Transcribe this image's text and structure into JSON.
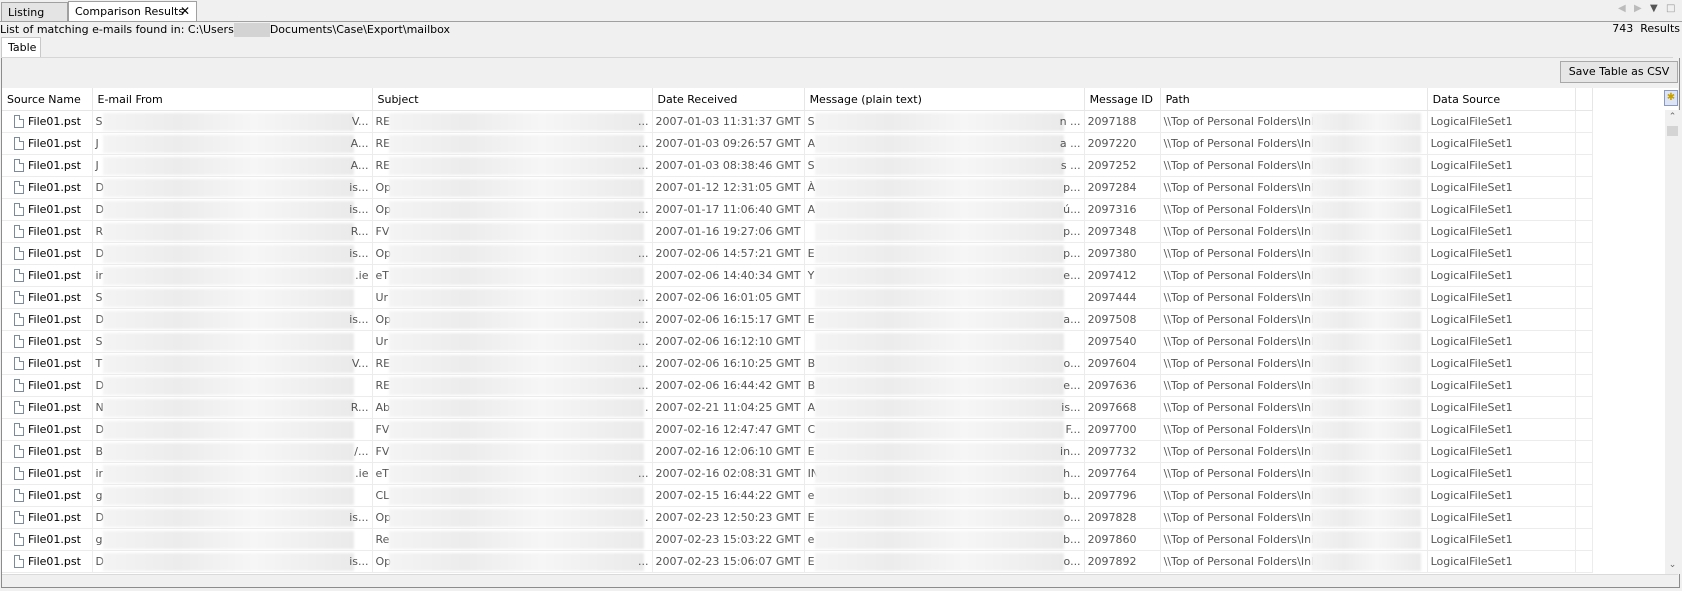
{
  "tabs": [
    {
      "label": "Listing",
      "active": false
    },
    {
      "label": "Comparison Results",
      "active": true,
      "closable": true
    }
  ],
  "tab_close_icon": "✕",
  "nav_icons": {
    "back": "◀",
    "forward": "▶",
    "menu": "▼",
    "maximize": "□"
  },
  "summary": {
    "prefix": "List of matching e-mails found in: C:\\Users",
    "suffix": "Documents\\Case\\Export\\mailbox",
    "result_count": "743",
    "result_label": "Results"
  },
  "subtabs": [
    {
      "label": "Table"
    }
  ],
  "toolbar": {
    "save_csv_label": "Save Table as CSV"
  },
  "table": {
    "columns": [
      "Source Name",
      "E-mail From",
      "Subject",
      "Date Received",
      "Message (plain text)",
      "Message ID",
      "Path",
      "Data Source"
    ],
    "rows": [
      {
        "source": "File01.pst",
        "from_start": "S",
        "from_end": "V...",
        "subject_start": "RE",
        "subject_end": "...",
        "date": "2007-01-03 11:31:37 GMT",
        "msg_start": "S",
        "msg_end": "n ...",
        "id": "2097188",
        "path": "\\\\Top of Personal Folders\\Inbox\\",
        "ds": "LogicalFileSet1"
      },
      {
        "source": "File01.pst",
        "from_start": "J",
        "from_end": "A...",
        "subject_start": "RE",
        "subject_end": "...",
        "date": "2007-01-03 09:26:57 GMT",
        "msg_start": "A",
        "msg_end": "a ...",
        "id": "2097220",
        "path": "\\\\Top of Personal Folders\\Inbox\\",
        "ds": "LogicalFileSet1"
      },
      {
        "source": "File01.pst",
        "from_start": "J",
        "from_end": "A...",
        "subject_start": "RE",
        "subject_end": "...",
        "date": "2007-01-03 08:38:46 GMT",
        "msg_start": "S",
        "msg_end": "s ...",
        "id": "2097252",
        "path": "\\\\Top of Personal Folders\\Inbox\\",
        "ds": "LogicalFileSet1"
      },
      {
        "source": "File01.pst",
        "from_start": "D",
        "from_end": "is...",
        "subject_start": "Op",
        "subject_end": "",
        "date": "2007-01-12 12:31:05 GMT",
        "msg_start": "À",
        "msg_end": "p...",
        "id": "2097284",
        "path": "\\\\Top of Personal Folders\\Inbox\\",
        "ds": "LogicalFileSet1"
      },
      {
        "source": "File01.pst",
        "from_start": "D",
        "from_end": "is...",
        "subject_start": "Op",
        "subject_end": "...",
        "date": "2007-01-17 11:06:40 GMT",
        "msg_start": "A",
        "msg_end": "ú...",
        "id": "2097316",
        "path": "\\\\Top of Personal Folders\\Inbox\\",
        "ds": "LogicalFileSet1"
      },
      {
        "source": "File01.pst",
        "from_start": "R",
        "from_end": "R...",
        "subject_start": "FV",
        "subject_end": "",
        "date": "2007-01-16 19:27:06 GMT",
        "msg_start": "",
        "msg_end": "p...",
        "id": "2097348",
        "path": "\\\\Top of Personal Folders\\Inbox\\",
        "ds": "LogicalFileSet1"
      },
      {
        "source": "File01.pst",
        "from_start": "D",
        "from_end": "is...",
        "subject_start": "Op",
        "subject_end": "...",
        "date": "2007-02-06 14:57:21 GMT",
        "msg_start": "E",
        "msg_end": "p...",
        "id": "2097380",
        "path": "\\\\Top of Personal Folders\\Inbox\\",
        "ds": "LogicalFileSet1"
      },
      {
        "source": "File01.pst",
        "from_start": "ir",
        "from_end": ".ie",
        "subject_start": "eT",
        "subject_end": "",
        "date": "2007-02-06 14:40:34 GMT",
        "msg_start": "Y",
        "msg_end": "e...",
        "id": "2097412",
        "path": "\\\\Top of Personal Folders\\Inbox\\",
        "ds": "LogicalFileSet1"
      },
      {
        "source": "File01.pst",
        "from_start": "S",
        "from_end": "",
        "subject_start": "Ur",
        "subject_end": "...",
        "date": "2007-02-06 16:01:05 GMT",
        "msg_start": "",
        "msg_end": "",
        "id": "2097444",
        "path": "\\\\Top of Personal Folders\\Inbox\\",
        "ds": "LogicalFileSet1"
      },
      {
        "source": "File01.pst",
        "from_start": "D",
        "from_end": "is...",
        "subject_start": "Op",
        "subject_end": "...",
        "date": "2007-02-06 16:15:17 GMT",
        "msg_start": "E",
        "msg_end": "a...",
        "id": "2097508",
        "path": "\\\\Top of Personal Folders\\Inbox\\",
        "ds": "LogicalFileSet1"
      },
      {
        "source": "File01.pst",
        "from_start": "S",
        "from_end": "",
        "subject_start": "Ur",
        "subject_end": "...",
        "date": "2007-02-06 16:12:10 GMT",
        "msg_start": "",
        "msg_end": "",
        "id": "2097540",
        "path": "\\\\Top of Personal Folders\\Inbox\\",
        "ds": "LogicalFileSet1"
      },
      {
        "source": "File01.pst",
        "from_start": "T",
        "from_end": "V...",
        "subject_start": "RE",
        "subject_end": "...",
        "date": "2007-02-06 16:10:25 GMT",
        "msg_start": "B",
        "msg_end": "o...",
        "id": "2097604",
        "path": "\\\\Top of Personal Folders\\Inbox\\",
        "ds": "LogicalFileSet1"
      },
      {
        "source": "File01.pst",
        "from_start": "D",
        "from_end": "",
        "subject_start": "RE",
        "subject_end": "...",
        "date": "2007-02-06 16:44:42 GMT",
        "msg_start": "B",
        "msg_end": "e...",
        "id": "2097636",
        "path": "\\\\Top of Personal Folders\\Inbox\\",
        "ds": "LogicalFileSet1"
      },
      {
        "source": "File01.pst",
        "from_start": "N",
        "from_end": "R...",
        "subject_start": "Ab",
        "subject_end": ".",
        "date": "2007-02-21 11:04:25 GMT",
        "msg_start": "A",
        "msg_end": "is...",
        "id": "2097668",
        "path": "\\\\Top of Personal Folders\\Inbox\\",
        "ds": "LogicalFileSet1"
      },
      {
        "source": "File01.pst",
        "from_start": "D",
        "from_end": "",
        "subject_start": "FV",
        "subject_end": "",
        "date": "2007-02-16 12:47:47 GMT",
        "msg_start": "C",
        "msg_end": "F...",
        "id": "2097700",
        "path": "\\\\Top of Personal Folders\\Inbox\\",
        "ds": "LogicalFileSet1"
      },
      {
        "source": "File01.pst",
        "from_start": "B",
        "from_end": "/...",
        "subject_start": "FV",
        "subject_end": "",
        "date": "2007-02-16 12:06:10 GMT",
        "msg_start": "E",
        "msg_end": "in...",
        "id": "2097732",
        "path": "\\\\Top of Personal Folders\\Inbox\\",
        "ds": "LogicalFileSet1"
      },
      {
        "source": "File01.pst",
        "from_start": "ir",
        "from_end": ".ie",
        "subject_start": "eT",
        "subject_end": "...",
        "date": "2007-02-16 02:08:31 GMT",
        "msg_start": "IN",
        "msg_end": "h...",
        "id": "2097764",
        "path": "\\\\Top of Personal Folders\\Inbox\\",
        "ds": "LogicalFileSet1"
      },
      {
        "source": "File01.pst",
        "from_start": "g",
        "from_end": "",
        "subject_start": "CL",
        "subject_end": "",
        "date": "2007-02-15 16:44:22 GMT",
        "msg_start": "e",
        "msg_end": "b...",
        "id": "2097796",
        "path": "\\\\Top of Personal Folders\\Inbox\\",
        "ds": "LogicalFileSet1"
      },
      {
        "source": "File01.pst",
        "from_start": "D",
        "from_end": "is...",
        "subject_start": "Op",
        "subject_end": ".",
        "date": "2007-02-23 12:50:23 GMT",
        "msg_start": "E",
        "msg_end": "o...",
        "id": "2097828",
        "path": "\\\\Top of Personal Folders\\Inbox\\",
        "ds": "LogicalFileSet1"
      },
      {
        "source": "File01.pst",
        "from_start": "g",
        "from_end": "",
        "subject_start": "Re",
        "subject_end": "",
        "date": "2007-02-23 15:03:22 GMT",
        "msg_start": "e",
        "msg_end": "b...",
        "id": "2097860",
        "path": "\\\\Top of Personal Folders\\Inbox\\",
        "ds": "LogicalFileSet1"
      },
      {
        "source": "File01.pst",
        "from_start": "D",
        "from_end": "is...",
        "subject_start": "Op",
        "subject_end": "...",
        "date": "2007-02-23 15:06:07 GMT",
        "msg_start": "E",
        "msg_end": "o...",
        "id": "2097892",
        "path": "\\\\Top of Personal Folders\\Inbox\\",
        "ds": "LogicalFileSet1"
      }
    ]
  },
  "scroll_icons": {
    "up": "⌃",
    "down": "⌄"
  }
}
